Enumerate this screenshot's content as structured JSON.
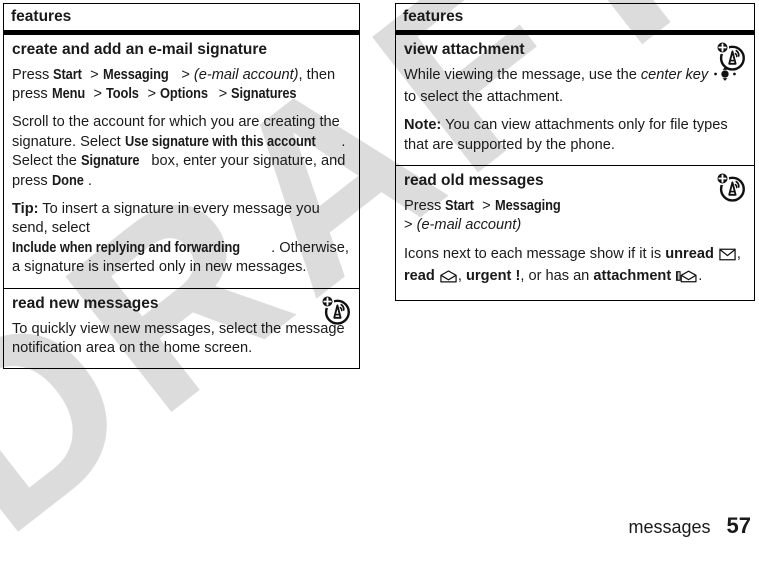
{
  "document": {
    "watermark": "DRAFT",
    "footer": {
      "chapter": "messages",
      "page_number": "57"
    }
  },
  "columns": [
    {
      "header": "features",
      "sections": [
        {
          "title": "create and add an e-mail signature",
          "icon": null,
          "paragraphs": [
            {
              "runs": [
                {
                  "t": "Press ",
                  "s": "n"
                },
                {
                  "t": "Start",
                  "s": "b"
                },
                {
                  "t": " > ",
                  "s": "n"
                },
                {
                  "t": "Messaging",
                  "s": "b"
                },
                {
                  "t": " > ",
                  "s": "n"
                },
                {
                  "t": "(e-mail account)",
                  "s": "i"
                },
                {
                  "t": ", then press ",
                  "s": "n"
                },
                {
                  "t": "Menu",
                  "s": "b"
                },
                {
                  "t": " > ",
                  "s": "n"
                },
                {
                  "t": "Tools",
                  "s": "b"
                },
                {
                  "t": " > ",
                  "s": "n"
                },
                {
                  "t": "Options",
                  "s": "b"
                },
                {
                  "t": " > ",
                  "s": "n"
                },
                {
                  "t": "Signatures",
                  "s": "b"
                }
              ]
            },
            {
              "runs": [
                {
                  "t": "Scroll to the account for which you are creating the signature. Select ",
                  "s": "n"
                },
                {
                  "t": "Use signature with this account",
                  "s": "b"
                },
                {
                  "t": ". Select the ",
                  "s": "n"
                },
                {
                  "t": "Signature",
                  "s": "b"
                },
                {
                  "t": " box, enter your signature, and press ",
                  "s": "n"
                },
                {
                  "t": "Done",
                  "s": "b"
                },
                {
                  "t": ".",
                  "s": "n"
                }
              ]
            },
            {
              "runs": [
                {
                  "t": "Tip:",
                  "s": "bn"
                },
                {
                  "t": " To insert a signature in every message you send, select ",
                  "s": "n"
                },
                {
                  "t": "Include when replying and forwarding",
                  "s": "b"
                },
                {
                  "t": ". Otherwise, a signature is inserted only in new messages.",
                  "s": "n"
                }
              ]
            }
          ]
        },
        {
          "title": "read new messages",
          "icon": "motorola-feature-icon",
          "paragraphs": [
            {
              "runs": [
                {
                  "t": "To quickly view new messages, select the message notification area on the home screen.",
                  "s": "n"
                }
              ]
            }
          ]
        }
      ]
    },
    {
      "header": "features",
      "sections": [
        {
          "title": "view attachment",
          "icon": "motorola-feature-icon",
          "paragraphs": [
            {
              "runs": [
                {
                  "t": "While viewing the message, use the ",
                  "s": "n"
                },
                {
                  "t": "center key",
                  "s": "i"
                },
                {
                  "t": " ",
                  "s": "n"
                },
                {
                  "t": "center-key-icon",
                  "s": "glyph"
                },
                {
                  "t": " to select the attachment.",
                  "s": "n"
                }
              ]
            },
            {
              "runs": [
                {
                  "t": "Note:",
                  "s": "bn"
                },
                {
                  "t": " You can view attachments only for file types that are supported by the phone.",
                  "s": "n"
                }
              ]
            }
          ]
        },
        {
          "title": "read old messages",
          "icon": "motorola-feature-icon",
          "paragraphs": [
            {
              "runs": [
                {
                  "t": "Press ",
                  "s": "n"
                },
                {
                  "t": "Start",
                  "s": "b"
                },
                {
                  "t": " > ",
                  "s": "n"
                },
                {
                  "t": "Messaging",
                  "s": "b"
                },
                {
                  "t": "\n> ",
                  "s": "n"
                },
                {
                  "t": "(e-mail account)",
                  "s": "i"
                }
              ]
            },
            {
              "runs": [
                {
                  "t": "Icons next to each message show if it is ",
                  "s": "n"
                },
                {
                  "t": "unread",
                  "s": "bn"
                },
                {
                  "t": " ",
                  "s": "n"
                },
                {
                  "t": "envelope-closed-icon",
                  "s": "glyph"
                },
                {
                  "t": ", ",
                  "s": "n"
                },
                {
                  "t": "read",
                  "s": "bn"
                },
                {
                  "t": " ",
                  "s": "n"
                },
                {
                  "t": "envelope-open-icon",
                  "s": "glyph"
                },
                {
                  "t": ", ",
                  "s": "n"
                },
                {
                  "t": "urgent",
                  "s": "bn"
                },
                {
                  "t": " ",
                  "s": "n"
                },
                {
                  "t": "!",
                  "s": "bn"
                },
                {
                  "t": ", or has an ",
                  "s": "n"
                },
                {
                  "t": "attachment",
                  "s": "bn"
                },
                {
                  "t": " ",
                  "s": "n"
                },
                {
                  "t": "attachment-envelope-icon",
                  "s": "glyph"
                },
                {
                  "t": ".",
                  "s": "n"
                }
              ]
            }
          ]
        }
      ]
    }
  ],
  "colors": {
    "text": "#1a1a1a",
    "rule": "#000000",
    "watermark": "#dcdcdc",
    "background": "#ffffff"
  }
}
